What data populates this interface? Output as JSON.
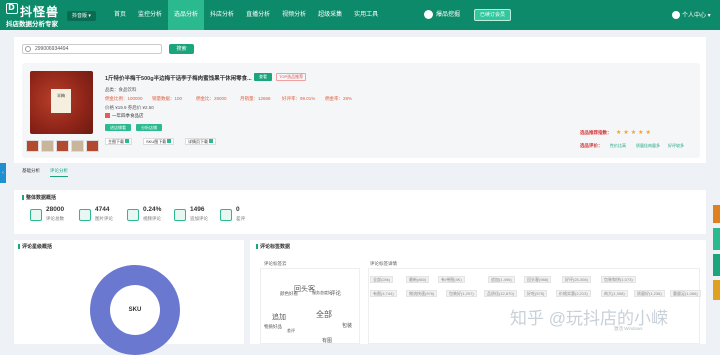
{
  "header": {
    "logo": "抖怪兽",
    "logo_mark": "D",
    "slogan": "抖店数据分析专家",
    "platform": "抖音版",
    "nav": [
      "首页",
      "监控分析",
      "选品分析",
      "抖店分析",
      "直播分析",
      "视频分析",
      "超级采集",
      "实用工具"
    ],
    "highlight": "爆品挖掘",
    "vip": "已续订会员",
    "user": "个人中心"
  },
  "search": {
    "value": "299006934494",
    "button": "搜索"
  },
  "product": {
    "title": "1斤特价半梅干500g半边梅干话李子梅肉蜜饯果干休闲零食...",
    "tag1": "查看",
    "tag2": "TOP选品推荐",
    "cat": "品类：食品饮料",
    "price_low": "佣金比例：100000",
    "sales": "销量数据：100",
    "rate": "佣金比：28000",
    "sales2": "月销量：12668",
    "rate2": "好评率：99.01%",
    "level": "佣金率：28%",
    "price": "价格 ¥19.9  券后价 ¥2.50",
    "shop": "一年四季食品店",
    "btn_store": "进店铺看",
    "btn_analysis": "分析店铺",
    "dl1": "主图下载",
    "dl2": "SKU图下载",
    "dl3": "详情页下载",
    "rec_label": "选品推荐指数：",
    "stars": "★★★★★",
    "rec_eval": "选品评价：",
    "rec_tags": [
      "性价比高",
      "质量佳肉量多",
      "好评较多"
    ]
  },
  "side": {
    "tab": "‹"
  },
  "tabs": [
    "基础分析",
    "评论分析"
  ],
  "overview": {
    "title": "整体数据概括",
    "stats": [
      {
        "value": "28000",
        "label": "评论总数"
      },
      {
        "value": "4744",
        "label": "图片评论"
      },
      {
        "value": "0.24%",
        "label": "视频评论"
      },
      {
        "value": "1496",
        "label": "追加评论"
      },
      {
        "value": "0",
        "label": "差评"
      }
    ]
  },
  "left": {
    "title": "评论星级概括",
    "center": "SKU"
  },
  "right": {
    "title": "评论标签数据",
    "cloud_label": "评论标签云",
    "detail_label": "评论标签详情",
    "cloud_words": [
      "回头客",
      "颜色好看",
      "服务态度好",
      "评论",
      "追加",
      "全部",
      "物质好品",
      "包装",
      "差评",
      "有图"
    ],
    "tags": [
      "全部(28k)",
      "最新(860)",
      "有/带图(4K)",
      "追加(1,496)",
      "回头客(988)",
      "好评(25,308)",
      "包装和饼(1,073)",
      "有图(4,744)",
      "物流快速(976)",
      "包装好(1,297)",
      "品质佳(12,870)",
      "好吃(575)",
      "价格实惠(2,213)",
      "肉大(1,398)",
      "质量好(1,236)",
      "重量足(1,066)"
    ]
  },
  "watermark": "知乎 @玩抖店的小嵘",
  "watermark2": "激活 Windows"
}
